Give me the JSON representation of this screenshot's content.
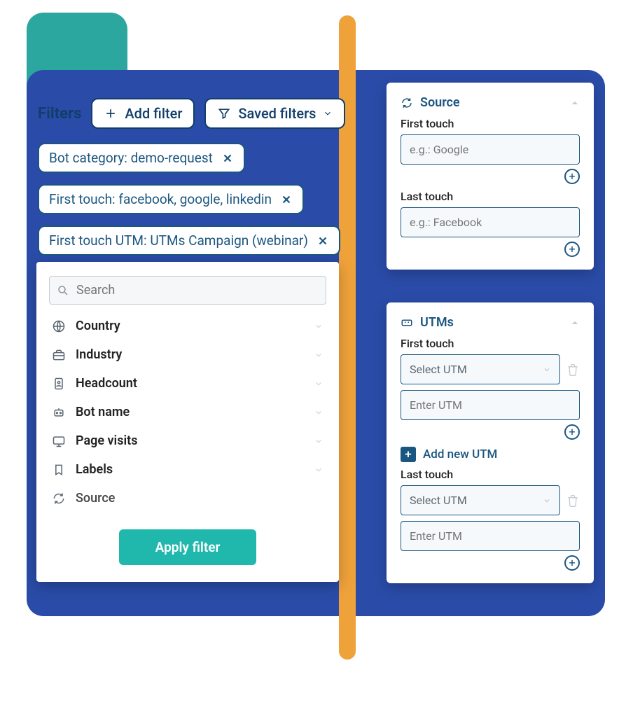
{
  "colors": {
    "primary": "#1b5680",
    "accent": "#20b8ad",
    "cardBlue": "#2a4ca8",
    "teal": "#2ca79f",
    "orange": "#f0a23a"
  },
  "filter_bar": {
    "title": "Filters",
    "add_filter_label": "Add filter",
    "saved_filters_label": "Saved filters",
    "applied": [
      "Bot category: demo-request",
      "First touch: facebook, google, linkedin",
      "First touch UTM: UTMs Campaign (webinar)"
    ]
  },
  "filter_panel": {
    "search_placeholder": "Search",
    "categories": [
      {
        "name": "Country",
        "icon": "globe-icon"
      },
      {
        "name": "Industry",
        "icon": "briefcase-icon"
      },
      {
        "name": "Headcount",
        "icon": "id-badge-icon"
      },
      {
        "name": "Bot name",
        "icon": "bot-icon"
      },
      {
        "name": "Page visits",
        "icon": "monitor-icon"
      },
      {
        "name": "Labels",
        "icon": "bookmark-icon"
      },
      {
        "name": "Source",
        "icon": "refresh-icon",
        "no_chevron": true,
        "muted": true
      }
    ],
    "apply_label": "Apply filter"
  },
  "source_card": {
    "title": "Source",
    "first_touch_label": "First touch",
    "first_touch_placeholder": "e.g.: Google",
    "last_touch_label": "Last touch",
    "last_touch_placeholder": "e.g.: Facebook"
  },
  "utms_card": {
    "title": "UTMs",
    "first_touch_label": "First touch",
    "select_placeholder": "Select UTM",
    "input_placeholder": "Enter UTM",
    "add_new_label": "Add new UTM",
    "last_touch_label": "Last touch"
  }
}
